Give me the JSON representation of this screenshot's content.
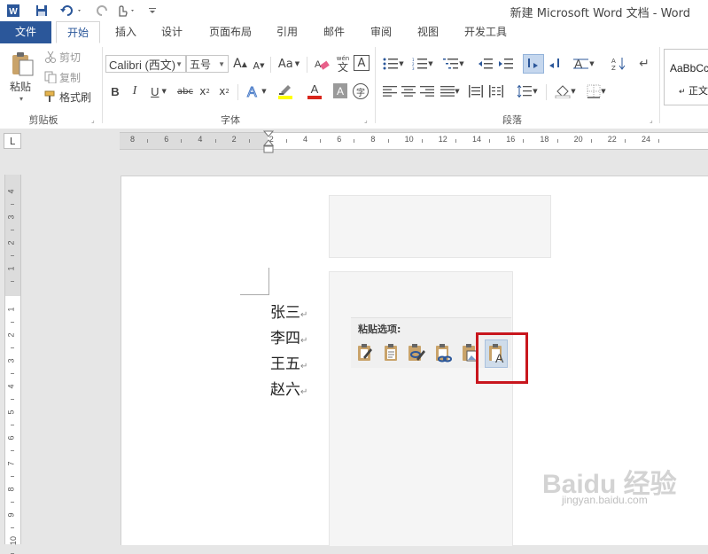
{
  "window": {
    "title": "新建 Microsoft Word 文档 - Word"
  },
  "tabs": [
    {
      "label": "文件"
    },
    {
      "label": "开始"
    },
    {
      "label": "插入"
    },
    {
      "label": "设计"
    },
    {
      "label": "页面布局"
    },
    {
      "label": "引用"
    },
    {
      "label": "邮件"
    },
    {
      "label": "审阅"
    },
    {
      "label": "视图"
    },
    {
      "label": "开发工具"
    }
  ],
  "clipboard": {
    "paste_label": "粘贴",
    "cut_label": "剪切",
    "copy_label": "复制",
    "format_painter_label": "格式刷",
    "group_label": "剪贴板"
  },
  "font": {
    "font_name": "Calibri (西文)",
    "font_size": "五号",
    "group_label": "字体",
    "grow_label": "A",
    "shrink_label": "A",
    "case_label": "Aa",
    "phonetic_label": "wén",
    "border_char_label": "A",
    "bold_label": "B",
    "italic_label": "I",
    "underline_label": "U",
    "strike_label": "abc",
    "subscript_label": "x",
    "superscript_label": "x",
    "enclose_char_label": "字"
  },
  "paragraph": {
    "group_label": "段落"
  },
  "styles": {
    "style_preview": "AaBbCc",
    "style_name": "正文"
  },
  "ruler": {
    "tab_selector": "L",
    "h_numbers": [
      "8",
      "6",
      "4",
      "2",
      "2",
      "4",
      "6",
      "8",
      "10",
      "12",
      "14",
      "16",
      "18",
      "20",
      "22",
      "24"
    ],
    "v_numbers": [
      "4",
      "3",
      "2",
      "1",
      "1",
      "2",
      "3",
      "4",
      "5",
      "6",
      "7",
      "8",
      "9",
      "10"
    ]
  },
  "document": {
    "lines": [
      "张三",
      "李四",
      "王五",
      "赵六"
    ],
    "para_mark": "↵"
  },
  "paste_options": {
    "label": "粘贴选项:",
    "icons": [
      "keep-source-formatting-icon",
      "merge-formatting-icon",
      "use-destination-styles-icon",
      "link-keep-source-icon",
      "paste-as-picture-icon",
      "keep-text-only-icon"
    ]
  },
  "watermark": {
    "text": "Baidu 经验",
    "subtext": "jingyan.baidu.com"
  },
  "colors": {
    "accent": "#2b579a",
    "highlight_box": "#c8161d",
    "font_color": "#d9261c",
    "highlight_color": "#ffff00"
  }
}
